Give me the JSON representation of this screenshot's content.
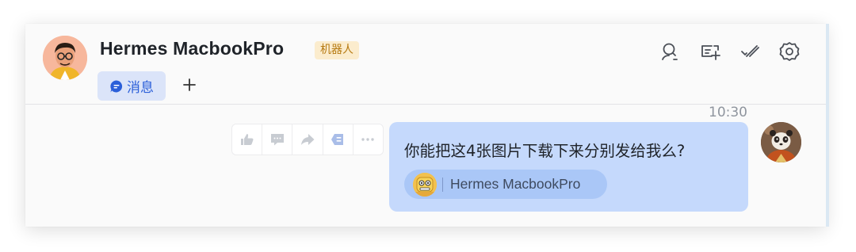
{
  "header": {
    "title": "Hermes MacbookPro",
    "bot_tag": "机器人",
    "tabs": [
      {
        "label": "消息",
        "active": true
      }
    ],
    "toolbar_icons": [
      "search-icon",
      "add-topic-icon",
      "checklist-icon",
      "settings-icon"
    ]
  },
  "chat": {
    "timestamp": "10:30",
    "message": {
      "text": "你能把这4张图片下载下来分别发给我么?",
      "mention": "Hermes MacbookPro"
    },
    "message_actions": [
      "thumbs-up-icon",
      "comment-icon",
      "forward-icon",
      "reaction-icon",
      "more-icon"
    ]
  },
  "colors": {
    "accent": "#2b5fd9",
    "bubble": "#c5d9fc",
    "mention_chip": "#aac7f7",
    "bot_tag_bg": "#fbeccd",
    "bot_tag_text": "#b67a11"
  }
}
